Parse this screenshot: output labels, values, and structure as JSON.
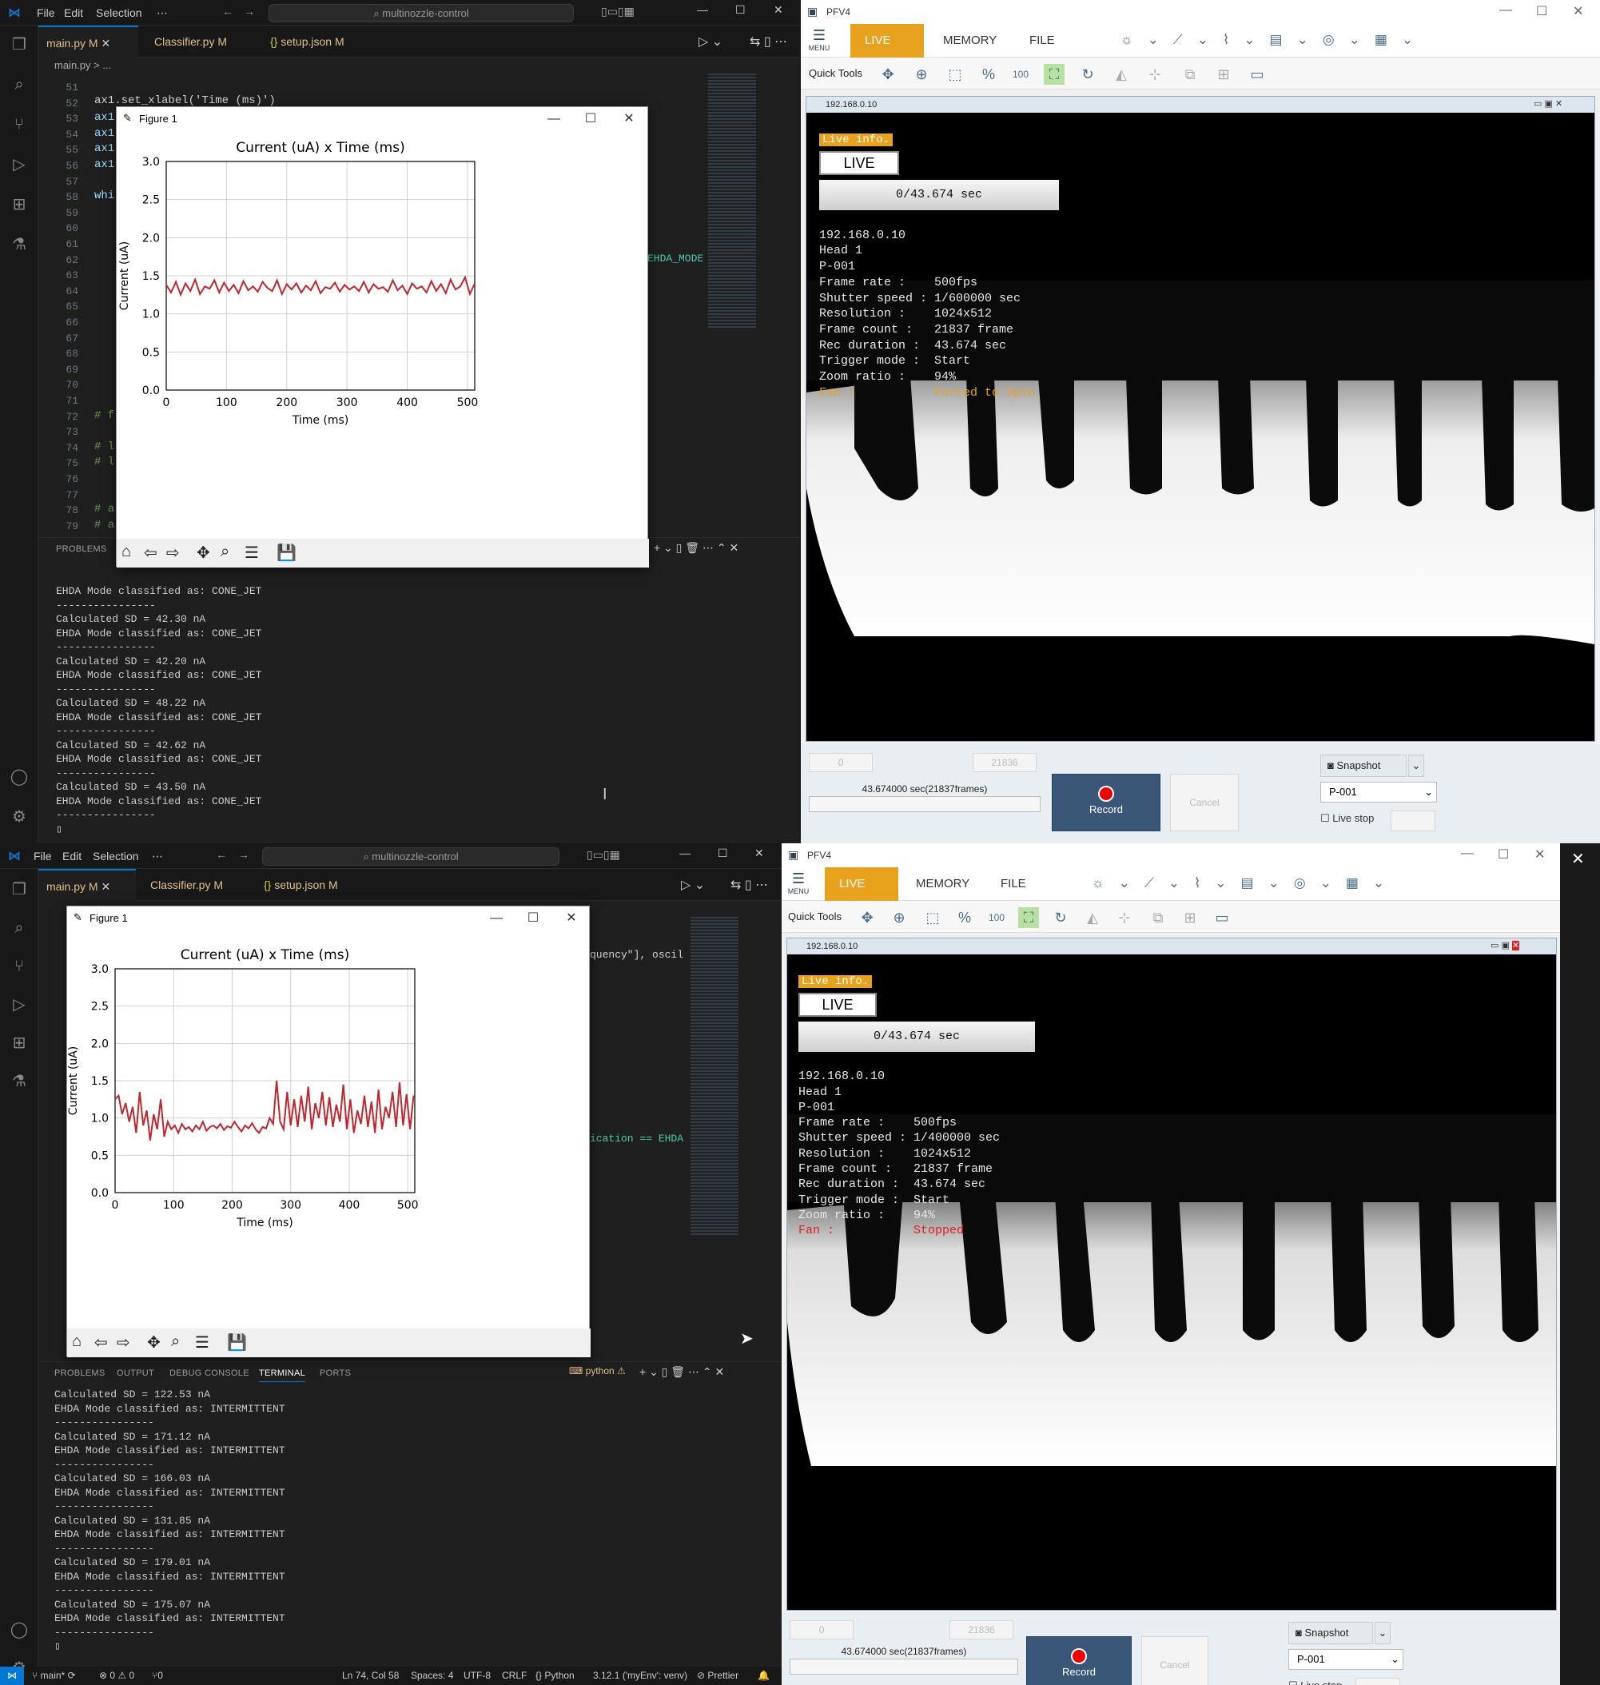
{
  "vscode": {
    "menu": [
      "File",
      "Edit",
      "Selection",
      "⋯"
    ],
    "search_placeholder": "multinozzle-control",
    "tabs": [
      {
        "label": "main.py",
        "badge": "M"
      },
      {
        "label": "Classifier.py",
        "badge": "M"
      },
      {
        "label": "setup.json",
        "badge": "M"
      }
    ],
    "breadcrumb": "main.py > ...",
    "top_lines": [
      "51",
      "52",
      "53",
      "54",
      "55",
      "56",
      "57",
      "58",
      "59",
      "60",
      "61",
      "62",
      "63",
      "64",
      "65",
      "66",
      "67",
      "68",
      "69",
      "70",
      "71",
      "72",
      "73",
      "74",
      "75",
      "76",
      "77",
      "78",
      "79"
    ],
    "top_code_xlabel": "ax1.set_xlabel('Time (ms)')",
    "top_code_fragments": [
      "ax1",
      "ax1",
      "ax1",
      "ax1",
      "whi",
      "# f",
      "# l",
      "# l",
      "# a",
      "# a"
    ],
    "top_code_right": "EHDA_MODE",
    "bottom_code_right_1": "quency\"], oscil",
    "bottom_code_right_2": "ication == EHDA",
    "panel_tabs": [
      "PROBLEMS",
      "OUTPUT",
      "DEBUG CONSOLE",
      "TERMINAL",
      "PORTS"
    ],
    "panel_python": "python",
    "top_terminal": [
      "EHDA Mode classified as: CONE_JET",
      "----------------",
      "Calculated SD = 42.30 nA",
      "EHDA Mode classified as: CONE_JET",
      "----------------",
      "Calculated SD = 42.20 nA",
      "EHDA Mode classified as: CONE_JET",
      "----------------",
      "Calculated SD = 48.22 nA",
      "EHDA Mode classified as: CONE_JET",
      "----------------",
      "Calculated SD = 42.62 nA",
      "EHDA Mode classified as: CONE_JET",
      "----------------",
      "Calculated SD = 43.50 nA",
      "EHDA Mode classified as: CONE_JET",
      "----------------"
    ],
    "bottom_terminal": [
      "Calculated SD = 122.53 nA",
      "EHDA Mode classified as: INTERMITTENT",
      "----------------",
      "Calculated SD = 171.12 nA",
      "EHDA Mode classified as: INTERMITTENT",
      "----------------",
      "Calculated SD = 166.03 nA",
      "EHDA Mode classified as: INTERMITTENT",
      "----------------",
      "Calculated SD = 131.85 nA",
      "EHDA Mode classified as: INTERMITTENT",
      "----------------",
      "Calculated SD = 179.01 nA",
      "EHDA Mode classified as: INTERMITTENT",
      "----------------",
      "Calculated SD = 175.07 nA",
      "EHDA Mode classified as: INTERMITTENT",
      "----------------"
    ],
    "statusbar": {
      "branch": "main*",
      "errors": "⊗ 0 ⚠ 0",
      "ports": "⑂0",
      "position": "Ln 74, Col 58",
      "spaces": "Spaces: 4",
      "encoding": "UTF-8",
      "eol": "CRLF",
      "language": "{} Python",
      "interpreter": "3.12.1 ('myEnv': venv)",
      "prettier": "⊘ Prettier"
    }
  },
  "figure": {
    "window_title": "Figure 1"
  },
  "chart_data": [
    {
      "type": "line",
      "title": "Current (uA) x Time (ms)",
      "xlabel": "Time (ms)",
      "ylabel": "Current (uA)",
      "xlim": [
        0,
        512
      ],
      "ylim": [
        0,
        3.0
      ],
      "xticks": [
        0,
        100,
        200,
        300,
        400,
        500
      ],
      "yticks": [
        0.0,
        0.5,
        1.0,
        1.5,
        2.0,
        2.5,
        3.0
      ],
      "grid": true,
      "series": [
        {
          "color": "#c0262d",
          "x": [
            0,
            8,
            16,
            24,
            32,
            40,
            48,
            56,
            64,
            72,
            80,
            88,
            96,
            104,
            112,
            120,
            128,
            136,
            144,
            152,
            160,
            168,
            176,
            184,
            192,
            200,
            208,
            216,
            224,
            232,
            240,
            248,
            256,
            264,
            272,
            280,
            288,
            296,
            304,
            312,
            320,
            328,
            336,
            344,
            352,
            360,
            368,
            376,
            384,
            392,
            400,
            408,
            416,
            424,
            432,
            440,
            448,
            456,
            464,
            472,
            480,
            488,
            496,
            504,
            512
          ],
          "values": [
            1.38,
            1.28,
            1.42,
            1.25,
            1.4,
            1.3,
            1.45,
            1.26,
            1.36,
            1.33,
            1.44,
            1.28,
            1.41,
            1.3,
            1.38,
            1.27,
            1.43,
            1.31,
            1.36,
            1.29,
            1.42,
            1.34,
            1.3,
            1.44,
            1.26,
            1.39,
            1.32,
            1.4,
            1.28,
            1.37,
            1.31,
            1.43,
            1.27,
            1.35,
            1.33,
            1.41,
            1.29,
            1.38,
            1.32,
            1.36,
            1.3,
            1.42,
            1.28,
            1.39,
            1.33,
            1.35,
            1.29,
            1.44,
            1.31,
            1.37,
            1.26,
            1.4,
            1.33,
            1.36,
            1.28,
            1.43,
            1.3,
            1.39,
            1.27,
            1.45,
            1.32,
            1.36,
            1.48,
            1.26,
            1.4
          ]
        }
      ]
    },
    {
      "type": "line",
      "title": "Current (uA) x Time (ms)",
      "xlabel": "Time (ms)",
      "ylabel": "Current (uA)",
      "xlim": [
        0,
        512
      ],
      "ylim": [
        0,
        3.0
      ],
      "xticks": [
        0,
        100,
        200,
        300,
        400,
        500
      ],
      "yticks": [
        0.0,
        0.5,
        1.0,
        1.5,
        2.0,
        2.5,
        3.0
      ],
      "grid": true,
      "series": [
        {
          "color": "#c0262d",
          "x": [
            0,
            6,
            12,
            18,
            24,
            30,
            36,
            42,
            48,
            54,
            60,
            66,
            72,
            78,
            84,
            90,
            96,
            102,
            108,
            114,
            120,
            126,
            132,
            138,
            144,
            150,
            156,
            162,
            168,
            174,
            180,
            186,
            192,
            198,
            204,
            210,
            216,
            222,
            228,
            234,
            240,
            246,
            252,
            258,
            264,
            270,
            276,
            282,
            288,
            294,
            300,
            306,
            312,
            318,
            324,
            330,
            336,
            342,
            348,
            354,
            360,
            366,
            372,
            378,
            384,
            390,
            396,
            402,
            408,
            414,
            420,
            426,
            432,
            438,
            444,
            450,
            456,
            462,
            468,
            474,
            480,
            486,
            492,
            498,
            504,
            510
          ],
          "values": [
            1.25,
            1.3,
            1.05,
            1.2,
            0.95,
            1.15,
            0.8,
            1.35,
            0.9,
            1.1,
            0.7,
            1.05,
            0.85,
            1.25,
            0.75,
            0.95,
            0.85,
            0.9,
            0.8,
            0.92,
            0.85,
            0.88,
            0.82,
            0.9,
            0.85,
            0.95,
            0.83,
            0.88,
            0.9,
            0.86,
            0.92,
            0.84,
            0.89,
            0.87,
            0.95,
            0.88,
            0.82,
            0.9,
            0.86,
            0.93,
            0.85,
            0.8,
            0.88,
            0.86,
            1.0,
            0.92,
            1.5,
            0.95,
            0.85,
            1.35,
            0.9,
            1.25,
            0.88,
            1.3,
            0.95,
            1.42,
            0.85,
            1.2,
            1.0,
            1.35,
            0.9,
            1.28,
            0.88,
            1.18,
            0.95,
            1.45,
            0.85,
            1.25,
            0.8,
            1.1,
            0.92,
            1.3,
            0.88,
            1.22,
            0.8,
            1.38,
            0.85,
            1.15,
            1.0,
            1.35,
            0.88,
            1.48,
            0.9,
            1.32,
            0.85,
            1.3
          ]
        }
      ]
    }
  ],
  "pfv": {
    "window_title": "PFV4",
    "menu_label": "MENU",
    "ribbon_tabs": [
      "LIVE",
      "MEMORY",
      "FILE"
    ],
    "quick_tools_label": "Quick Tools",
    "quick_zoom_100": "100",
    "viewer_title": "192.168.0.10",
    "live_info_label": "Live info.",
    "live_button": "LIVE",
    "progress_text": "0/43.674 sec",
    "top_info": {
      "ip": "192.168.0.10",
      "head": "Head 1",
      "p": "P-001",
      "frame_rate": "Frame rate :    500fps",
      "shutter": "Shutter speed : 1/600000 sec",
      "resolution": "Resolution :    1024x512",
      "frame_count": "Frame count :   21837 frame",
      "rec_duration": "Rec duration :  43.674 sec",
      "trigger": "Trigger mode :  Start",
      "zoom": "Zoom ratio :    94%",
      "fan_label": "Fan :",
      "fan_value": "Forced to Spin"
    },
    "bottom_info": {
      "ip": "192.168.0.10",
      "head": "Head 1",
      "p": "P-001",
      "frame_rate": "Frame rate :    500fps",
      "shutter": "Shutter speed : 1/400000 sec",
      "resolution": "Resolution :    1024x512",
      "frame_count": "Frame count :   21837 frame",
      "rec_duration": "Rec duration :  43.674 sec",
      "trigger": "Trigger mode :  Start",
      "zoom": "Zoom ratio :    94%",
      "fan_label": "Fan :",
      "fan_value": "Stopped"
    },
    "spin_left": "0",
    "spin_right": "21836",
    "rec_time": "43.674000 sec(21837frames)",
    "record": "Record",
    "cancel": "Cancel",
    "snapshot": "Snapshot",
    "select_value": "P-001",
    "live_stop": "Live stop",
    "colors": {
      "accent": "#e8a21e",
      "record_bg": "#3a5778"
    }
  }
}
